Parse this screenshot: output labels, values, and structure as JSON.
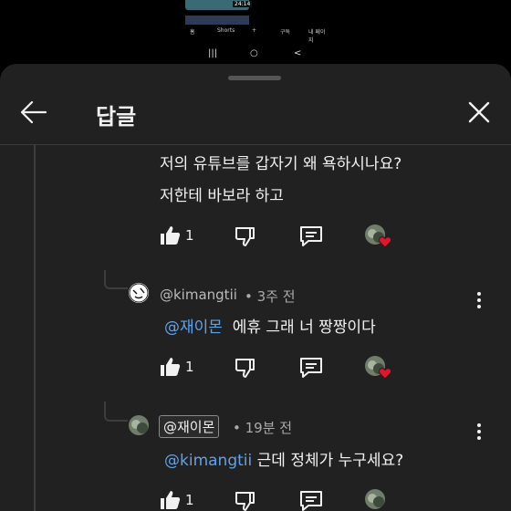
{
  "statusbar": {
    "mini_duration": "24:14",
    "mini_caption_1": "…",
    "mini_caption_2": "",
    "nav_labels": [
      "홈",
      "Shorts",
      "+",
      "구독",
      "내 페이지"
    ],
    "system_nav": [
      "|||",
      "○",
      "<"
    ]
  },
  "header": {
    "title": "답글"
  },
  "parent_comment": {
    "lines": [
      "저의 유튜브를 갑자기 왜 욕하시나요?",
      "저한테 바보라 하고"
    ],
    "likes": "1"
  },
  "replies": [
    {
      "author": "@kimangtii",
      "time": "• 3주 전",
      "mention": "@재이몬",
      "text": "에휴 그래 너 짱짱이다",
      "likes": "1"
    },
    {
      "author": "@재이몬",
      "time": "• 19분 전",
      "mention": "@kimangtii",
      "text": "근데 정체가 누구세요?",
      "likes": "1"
    }
  ],
  "colors": {
    "mention": "#5fa3e8",
    "heart": "#e8122b",
    "sheet_bg": "#212121"
  }
}
